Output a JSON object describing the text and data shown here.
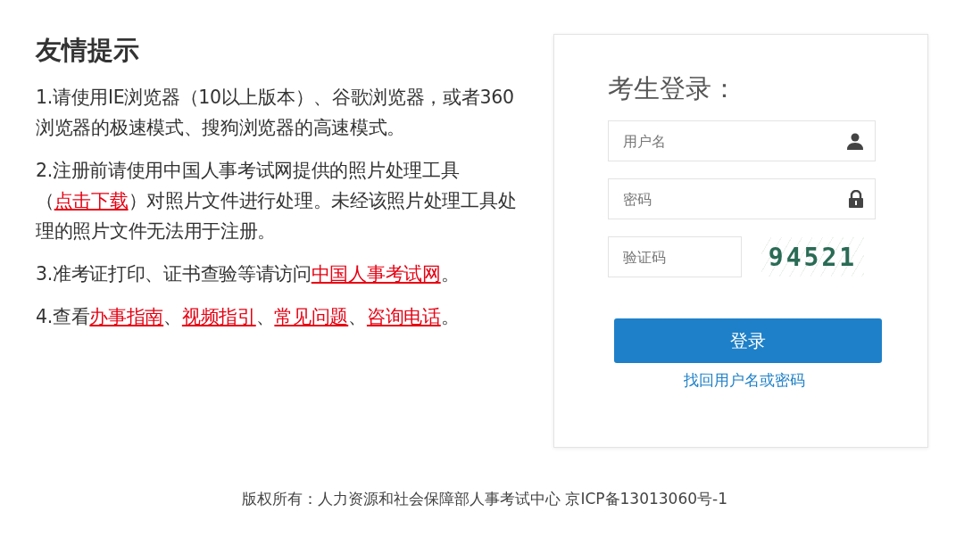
{
  "notice": {
    "title": "友情提示",
    "tips": [
      {
        "segments": [
          {
            "text": "1.请使用IE浏览器（10以上版本）、谷歌浏览器，或者360浏览器的极速模式、搜狗浏览器的高速模式。",
            "kind": "text"
          }
        ]
      },
      {
        "segments": [
          {
            "text": "2.注册前请使用中国人事考试网提供的照片处理工具（",
            "kind": "text"
          },
          {
            "text": "点击下载",
            "kind": "link"
          },
          {
            "text": "）对照片文件进行处理。未经该照片处理工具处理的照片文件无法用于注册。",
            "kind": "text"
          }
        ]
      },
      {
        "segments": [
          {
            "text": "3.准考证打印、证书查验等请访问",
            "kind": "text"
          },
          {
            "text": "中国人事考试网",
            "kind": "link"
          },
          {
            "text": "。",
            "kind": "text"
          }
        ]
      },
      {
        "segments": [
          {
            "text": "4.查看",
            "kind": "text"
          },
          {
            "text": "办事指南",
            "kind": "link"
          },
          {
            "text": "、",
            "kind": "text"
          },
          {
            "text": "视频指引",
            "kind": "link"
          },
          {
            "text": "、",
            "kind": "text"
          },
          {
            "text": "常见问题",
            "kind": "link"
          },
          {
            "text": "、",
            "kind": "text"
          },
          {
            "text": "咨询电话",
            "kind": "link"
          },
          {
            "text": "。",
            "kind": "text"
          }
        ]
      }
    ]
  },
  "login": {
    "title": "考生登录：",
    "fields": [
      {
        "kind": "username",
        "placeholder": "用户名"
      },
      {
        "kind": "password",
        "placeholder": "密码"
      },
      {
        "kind": "captcha",
        "placeholder": "验证码",
        "captcha": "94521"
      }
    ],
    "submit": "登录",
    "recover_link": "找回用户名或密码"
  },
  "footer": "版权所有：人力资源和社会保障部人事考试中心 京ICP备13013060号-1"
}
